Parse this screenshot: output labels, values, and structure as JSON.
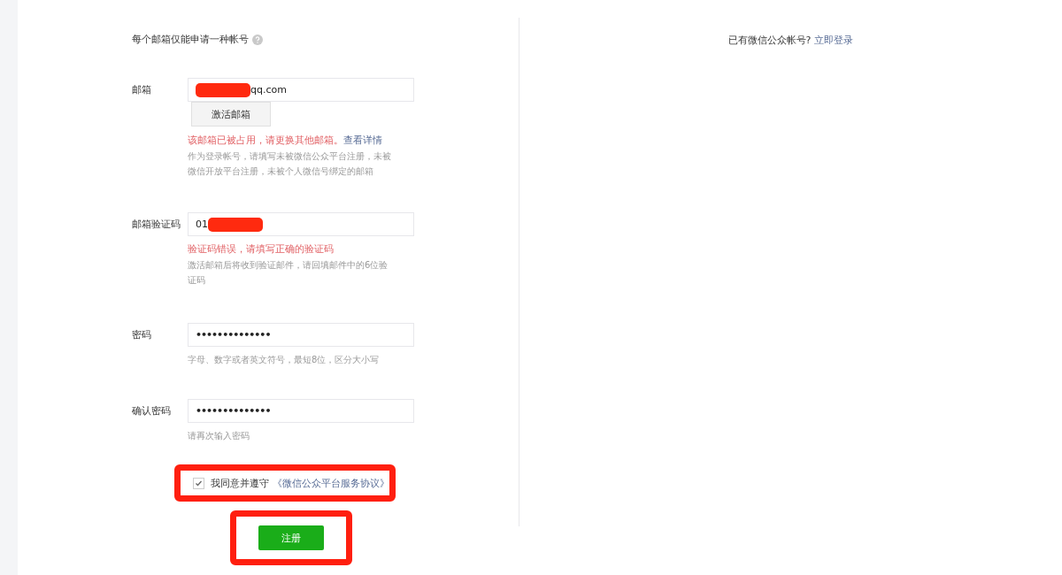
{
  "notice": {
    "text": "每个邮箱仅能申请一种帐号"
  },
  "login_prompt": {
    "text": "已有微信公众帐号?",
    "link": "立即登录"
  },
  "fields": [
    {
      "label": "邮箱",
      "kind": "text",
      "value": "qq.com",
      "redacted": true,
      "button": "激活邮箱",
      "error": "该邮箱已被占用，请更换其他邮箱。",
      "error_link": "查看详情",
      "hint": "作为登录帐号，请填写未被微信公众平台注册，未被微信开放平台注册，未被个人微信号绑定的邮箱"
    },
    {
      "label": "邮箱验证码",
      "kind": "text",
      "value": "01",
      "redacted": true,
      "error": "验证码错误，请填写正确的验证码",
      "hint": "激活邮箱后将收到验证邮件，请回填邮件中的6位验证码"
    },
    {
      "label": "密码",
      "kind": "password",
      "value": "••••••••••••••",
      "hint": "字母、数字或者英文符号，最短8位，区分大小写"
    },
    {
      "label": "确认密码",
      "kind": "password",
      "value": "••••••••••••••",
      "hint": "请再次输入密码"
    }
  ],
  "agreement": {
    "checked": true,
    "text": "我同意并遵守",
    "link": "《微信公众平台服务协议》",
    "highlighted": true
  },
  "submit": {
    "label": "注册",
    "highlighted": true
  }
}
